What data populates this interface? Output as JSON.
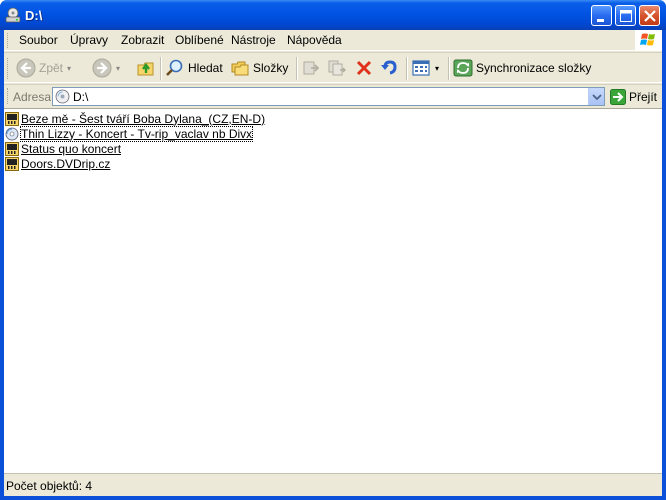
{
  "window": {
    "title": "D:\\"
  },
  "menu": {
    "items": [
      {
        "label": "Soubor"
      },
      {
        "label": "Úpravy"
      },
      {
        "label": "Zobrazit"
      },
      {
        "label": "Oblíbené"
      },
      {
        "label": "Nástroje"
      },
      {
        "label": "Nápověda"
      }
    ]
  },
  "toolbar": {
    "back_label": "Zpět",
    "search_label": "Hledat",
    "folders_label": "Složky",
    "sync_label": "Synchronizace složky"
  },
  "address": {
    "label": "Adresa",
    "value": "D:\\",
    "go_label": "Přejít"
  },
  "files": [
    {
      "name": "Beze mě - Šest tváří Boba Dylana_(CZ,EN-D)",
      "icon": "video-folder-icon",
      "selected": false
    },
    {
      "name": "Thin Lizzy - Koncert - Tv-rip_vaclav nb Divx",
      "icon": "cd-icon",
      "selected": true
    },
    {
      "name": "Status quo koncert",
      "icon": "video-folder-icon",
      "selected": false
    },
    {
      "name": "Doors.DVDrip.cz",
      "icon": "video-folder-icon",
      "selected": false
    }
  ],
  "status": {
    "text": "Počet objektů: 4"
  },
  "colors": {
    "titlebar": "#0054e3",
    "frame": "#ece9d8",
    "close_button": "#d6542d"
  }
}
